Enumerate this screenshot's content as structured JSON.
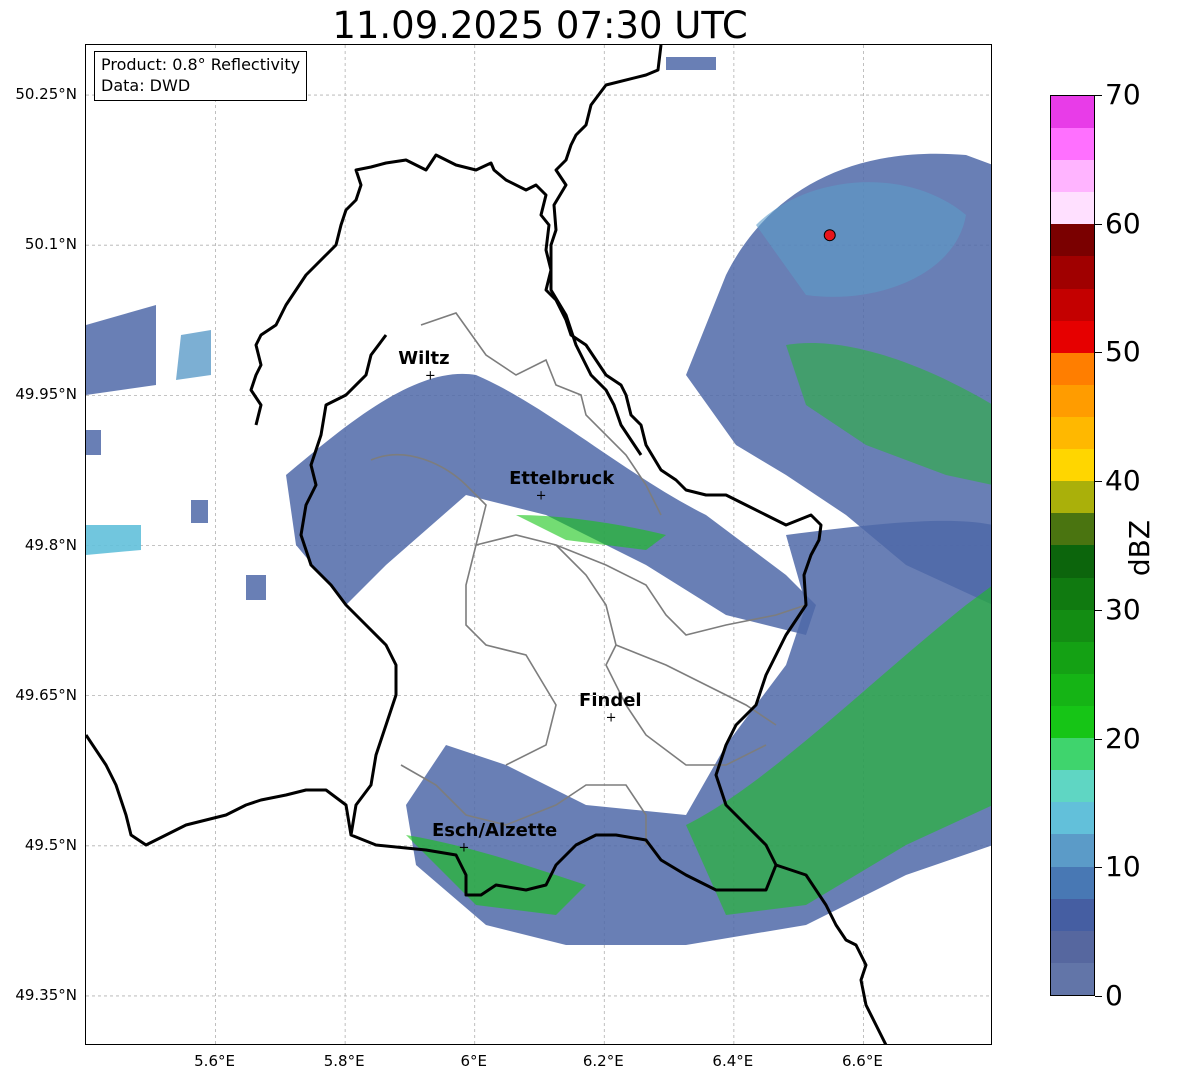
{
  "title": "11.09.2025 07:30 UTC",
  "info": {
    "product": "Product: 0.8° Reflectivity",
    "data": "Data: DWD"
  },
  "map": {
    "lat_range": [
      49.3,
      50.3
    ],
    "lon_range": [
      5.4,
      6.8
    ],
    "lat_ticks": [
      {
        "value": 50.25,
        "label": "50.25°N"
      },
      {
        "value": 50.1,
        "label": "50.1°N"
      },
      {
        "value": 49.95,
        "label": "49.95°N"
      },
      {
        "value": 49.8,
        "label": "49.8°N"
      },
      {
        "value": 49.65,
        "label": "49.65°N"
      },
      {
        "value": 49.5,
        "label": "49.5°N"
      },
      {
        "value": 49.35,
        "label": "49.35°N"
      }
    ],
    "lon_ticks": [
      {
        "value": 5.6,
        "label": "5.6°E"
      },
      {
        "value": 5.8,
        "label": "5.8°E"
      },
      {
        "value": 6.0,
        "label": "6°E"
      },
      {
        "value": 6.2,
        "label": "6.2°E"
      },
      {
        "value": 6.4,
        "label": "6.4°E"
      },
      {
        "value": 6.6,
        "label": "6.6°E"
      }
    ],
    "gridlines": true,
    "cities": [
      {
        "name": "Wiltz",
        "lat": 49.968,
        "lon": 5.933
      },
      {
        "name": "Ettelbruck",
        "lat": 49.848,
        "lon": 6.104
      },
      {
        "name": "Findel",
        "lat": 49.627,
        "lon": 6.212
      },
      {
        "name": "Esch/Alzette",
        "lat": 49.497,
        "lon": 5.985
      }
    ],
    "radar_site": {
      "lat": 50.11,
      "lon": 6.548,
      "color": "#e8141c"
    }
  },
  "colorbar": {
    "label": "dBZ",
    "min": 0,
    "max": 70,
    "step": 2.5,
    "ticks": [
      0,
      10,
      20,
      30,
      40,
      50,
      60,
      70
    ],
    "colors": [
      "#6275a8",
      "#56679f",
      "#455ea2",
      "#4878b4",
      "#5b9bc8",
      "#62c0da",
      "#5fd6c3",
      "#3fd46d",
      "#16c516",
      "#15b415",
      "#14a114",
      "#138d13",
      "#107a10",
      "#0c650c",
      "#4a7410",
      "#aab00a",
      "#ffd600",
      "#ffb800",
      "#ff9c00",
      "#ff7e00",
      "#e60000",
      "#c40000",
      "#a00000",
      "#7a0000",
      "#ffe0ff",
      "#ffb4ff",
      "#ff70ff",
      "#e83ce8"
    ]
  }
}
